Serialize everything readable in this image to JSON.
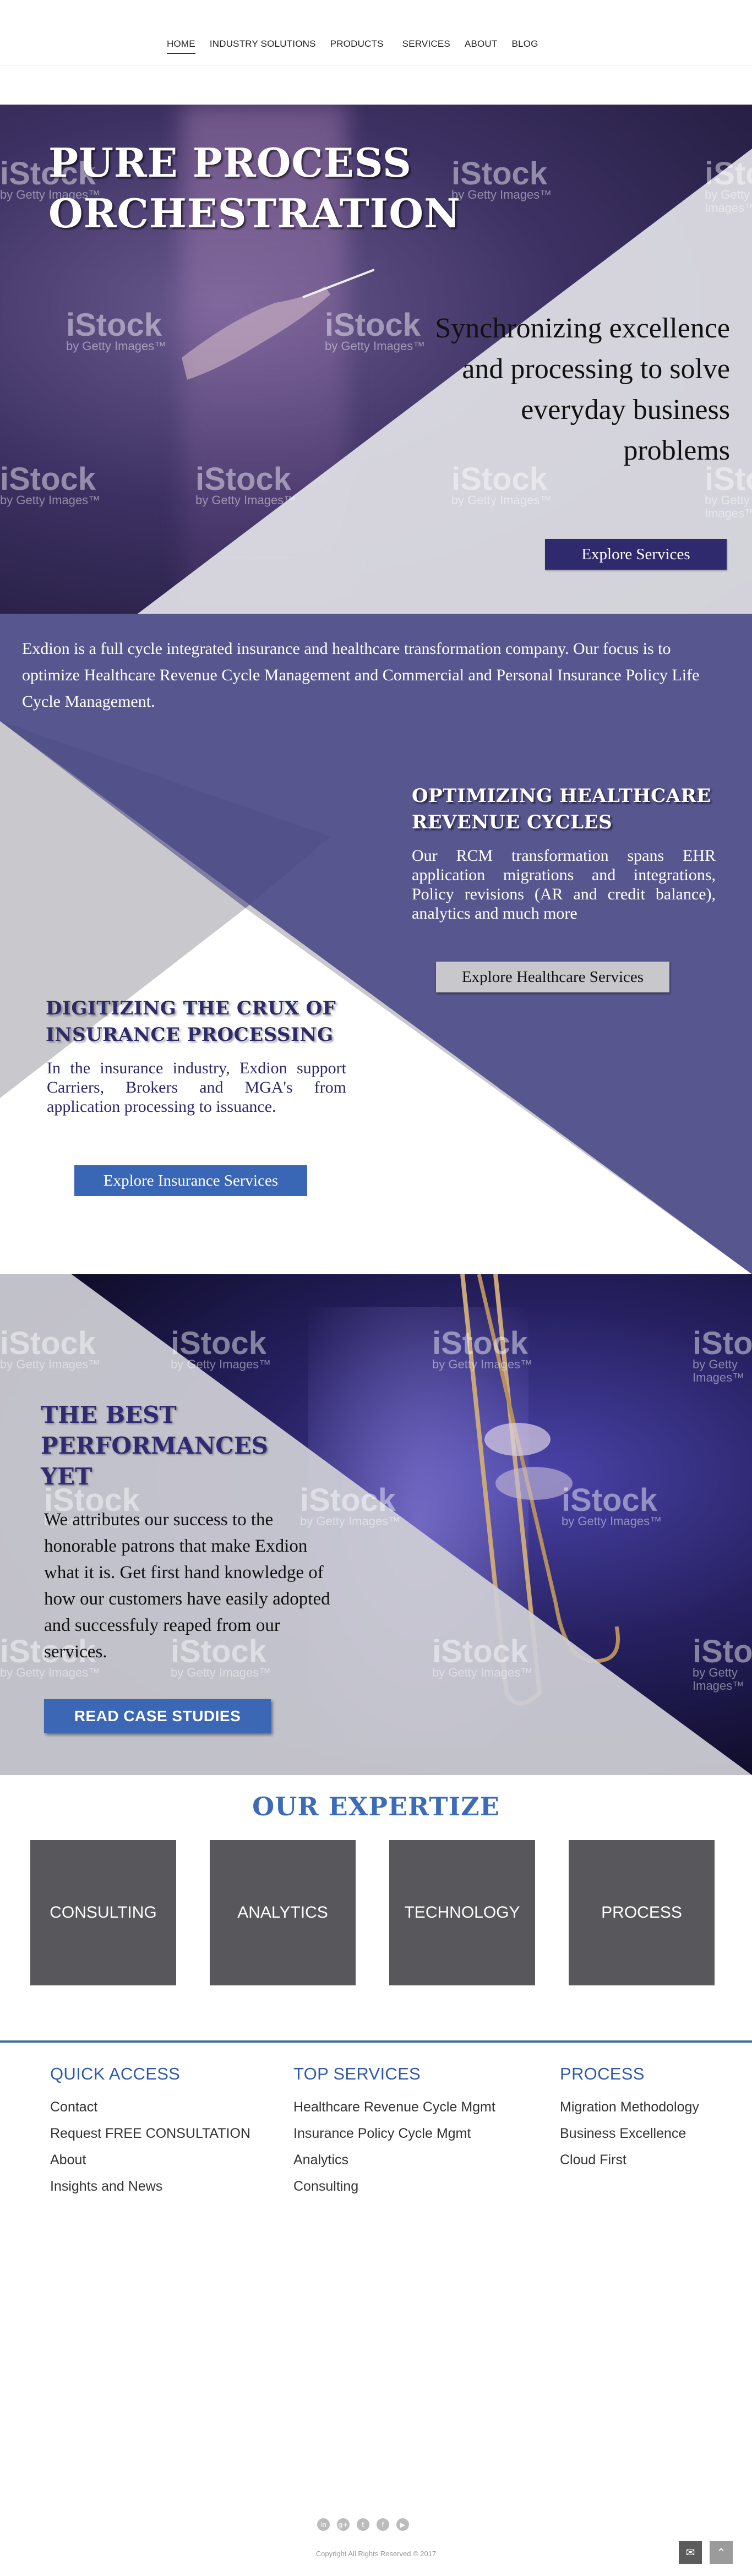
{
  "nav": {
    "items": [
      {
        "label": "HOME",
        "active": true
      },
      {
        "label": "INDUSTRY SOLUTIONS"
      },
      {
        "label": "PRODUCTS"
      },
      {
        "label": "SERVICES"
      },
      {
        "label": "ABOUT"
      },
      {
        "label": "BLOG"
      }
    ]
  },
  "hero": {
    "title": "PURE PROCESS ORCHESTRATION",
    "subtitle": "Synchronizing excellence and processing to solve everyday business problems",
    "button": "Explore Services"
  },
  "watermark": {
    "brand": "iStock",
    "by": "by Getty Images™"
  },
  "intro": {
    "text": "Exdion is a full cycle integrated insurance and healthcare transformation company. Our focus is to optimize Healthcare Revenue Cycle Management and Commercial and Personal Insurance Policy Life Cycle Management."
  },
  "healthcare": {
    "heading": "OPTIMIZING HEALTHCARE REVENUE CYCLES",
    "text": "Our RCM transformation spans EHR application migrations and integrations, Policy revisions (AR and credit balance), analytics and much more",
    "button": "Explore Healthcare Services"
  },
  "insurance": {
    "heading": "DIGITIZING THE CRUX OF INSURANCE PROCESSING",
    "text": "In the insurance industry, Exdion support Carriers, Brokers and MGA's from application processing to issuance.",
    "button": "Explore Insurance Services"
  },
  "performance": {
    "title": "THE BEST PERFORMANCES YET",
    "text": "We attributes our success to the honorable patrons that make Exdion what it is. Get first hand knowledge of how our customers have easily adopted and successfuly reaped from our services.",
    "button": "READ CASE STUDIES"
  },
  "expertize": {
    "title": "OUR EXPERTIZE",
    "tiles": [
      "CONSULTING",
      "ANALYTICS",
      "TECHNOLOGY",
      "PROCESS"
    ]
  },
  "footer": {
    "quick_access": {
      "title": "QUICK ACCESS",
      "links": [
        "Contact",
        "Request FREE CONSULTATION",
        "About",
        "Insights and News"
      ]
    },
    "top_services": {
      "title": "TOP SERVICES",
      "links": [
        "Healthcare Revenue Cycle Mgmt",
        "Insurance Policy Cycle Mgmt",
        "Analytics",
        "Consulting"
      ]
    },
    "process": {
      "title": "PROCESS",
      "links": [
        "Migration Methodology",
        "Business Excellence",
        "Cloud First"
      ]
    },
    "social_icons": [
      "linkedin-icon",
      "google-plus-icon",
      "twitter-icon",
      "facebook-icon",
      "youtube-icon"
    ],
    "social_glyphs": [
      "in",
      "g+",
      "t",
      "f",
      "▶"
    ],
    "copyright": "Copyright All Rights Reserved © 2017"
  },
  "colors": {
    "brand_dark": "#2f2a6e",
    "brand_blue": "#3a66b6",
    "service_purple": "#58568f",
    "tile_gray": "#58575b"
  }
}
